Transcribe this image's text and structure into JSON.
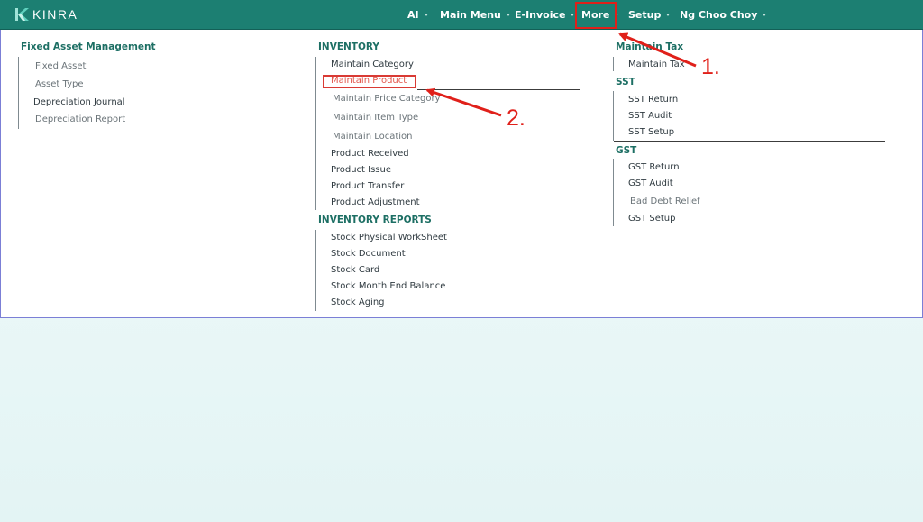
{
  "brand": {
    "logo_text": "KINRA"
  },
  "nav": {
    "items": [
      "AI",
      "Main Menu",
      "E-Invoice",
      "More",
      "Setup",
      "Ng Choo Choy"
    ]
  },
  "columns": {
    "fixed_asset": {
      "title": "Fixed Asset Management",
      "items": [
        "Fixed Asset",
        "Asset Type",
        "Depreciation Journal",
        "Depreciation Report"
      ]
    },
    "inventory": {
      "title": "INVENTORY",
      "items": [
        "Maintain Category",
        "Maintain Product",
        "Maintain Price Category",
        "Maintain Item Type",
        "Maintain Location",
        "Product Received",
        "Product Issue",
        "Product Transfer",
        "Product Adjustment"
      ]
    },
    "inventory_reports": {
      "title": "INVENTORY REPORTS",
      "items": [
        "Stock Physical WorkSheet",
        "Stock Document",
        "Stock Card",
        "Stock Month End Balance",
        "Stock Aging"
      ]
    },
    "maintain_tax": {
      "title": "Maintain Tax",
      "items": [
        "Maintain Tax"
      ]
    },
    "sst": {
      "title": "SST",
      "items": [
        "SST Return",
        "SST Audit",
        "SST Setup"
      ]
    },
    "gst": {
      "title": "GST",
      "items": [
        "GST Return",
        "GST Audit",
        "Bad Debt Relief",
        "GST Setup"
      ]
    }
  },
  "annotations": {
    "step1": "1.",
    "step2": "2."
  },
  "colors": {
    "navbar": "#1c7f72",
    "heading": "#1d6f64",
    "annotation_red": "#e0201a"
  },
  "icons": {
    "logo": "kinra-k-logo-icon",
    "caret": "caret-down-icon"
  }
}
